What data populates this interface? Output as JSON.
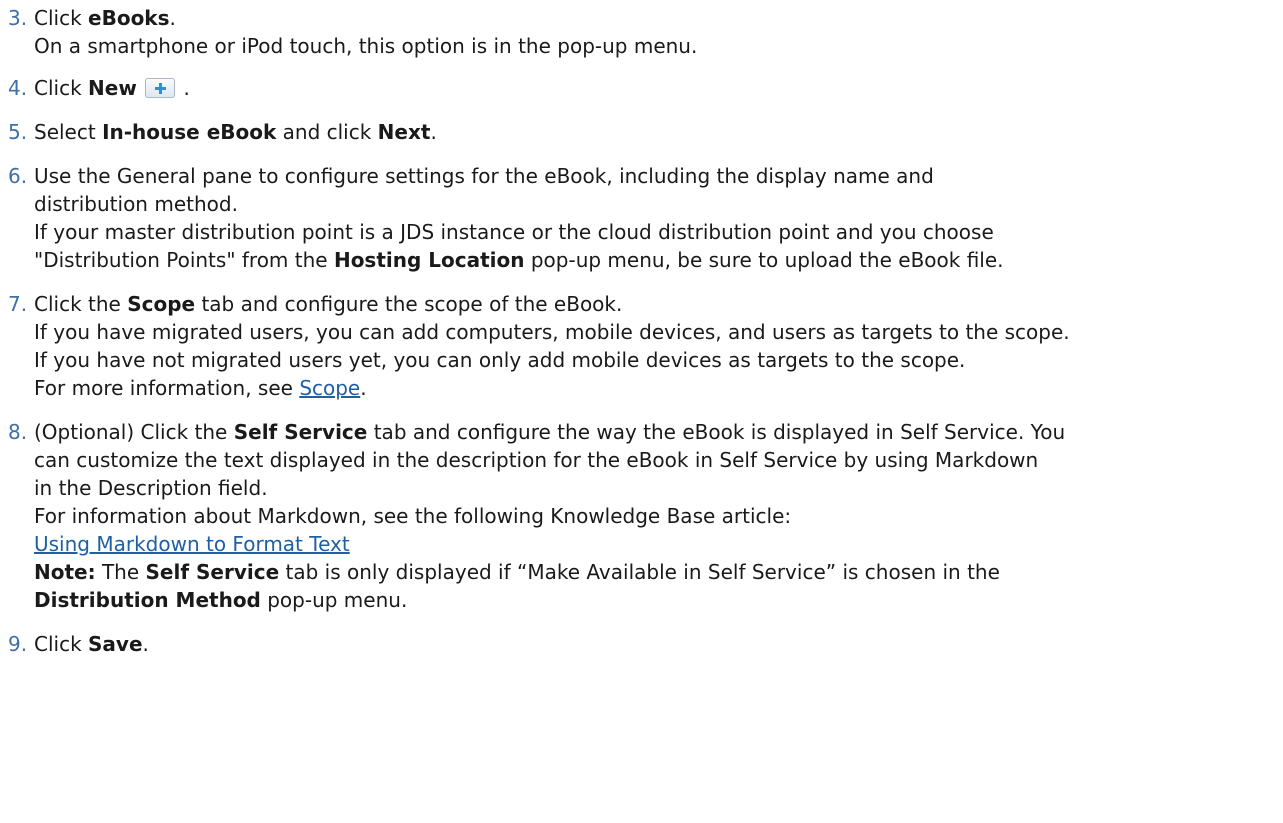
{
  "steps": [
    {
      "num": "3.",
      "pre": "Click ",
      "bold": "eBooks",
      "post": ".",
      "note": "On a smartphone or iPod touch, this option is in the pop-up menu."
    },
    {
      "num": "4.",
      "pre": "Click ",
      "bold": "New",
      "post": " .",
      "icon": "plus-icon"
    },
    {
      "num": "5.",
      "pre": "Select ",
      "bold1": "In-house eBook",
      "mid": " and click ",
      "bold2": "Next",
      "post": "."
    },
    {
      "num": "6.",
      "line1": "Use the General pane to configure settings for the eBook, including the display name and",
      "line2": "distribution method.",
      "line3": "If your master distribution point is a JDS instance or the cloud distribution point and you choose",
      "line4_pre": "\"Distribution Points\" from the ",
      "line4_bold": "Hosting Location",
      "line4_post": " pop-up menu, be sure to upload the eBook file."
    },
    {
      "num": "7.",
      "pre": "Click the ",
      "bold": "Scope",
      "post": " tab and configure the scope of the eBook.",
      "line2": "If you have migrated users, you can add computers, mobile devices, and users as targets to the scope.",
      "line3": "If you have not migrated users yet, you can only add mobile devices as targets to the scope.",
      "line4_pre": "For more information, see ",
      "line4_link": "Scope",
      "line4_post": "."
    },
    {
      "num": "8.",
      "pre": "(Optional) Click the ",
      "bold": "Self Service",
      "post": " tab and configure the way the eBook is displayed in Self Service. You",
      "line2": "can customize the text displayed in the description for the eBook in Self Service by using Markdown",
      "line3": "in the Description field.",
      "line4": "For information about Markdown, see the following Knowledge Base article:",
      "link": "Using Markdown to Format Text",
      "note_label": "Note:",
      "note_mid1": " The ",
      "note_bold": "Self Service",
      "note_post": " tab is only displayed if “Make Available in Self Service” is chosen in the",
      "note2_bold": "Distribution Method",
      "note2_post": " pop-up menu."
    },
    {
      "num": "9.",
      "pre": "Click ",
      "bold": "Save",
      "post": "."
    }
  ],
  "colors": {
    "step_number": "#3f6fa6",
    "link": "#1f5fa6",
    "text": "#1a1a1a"
  }
}
